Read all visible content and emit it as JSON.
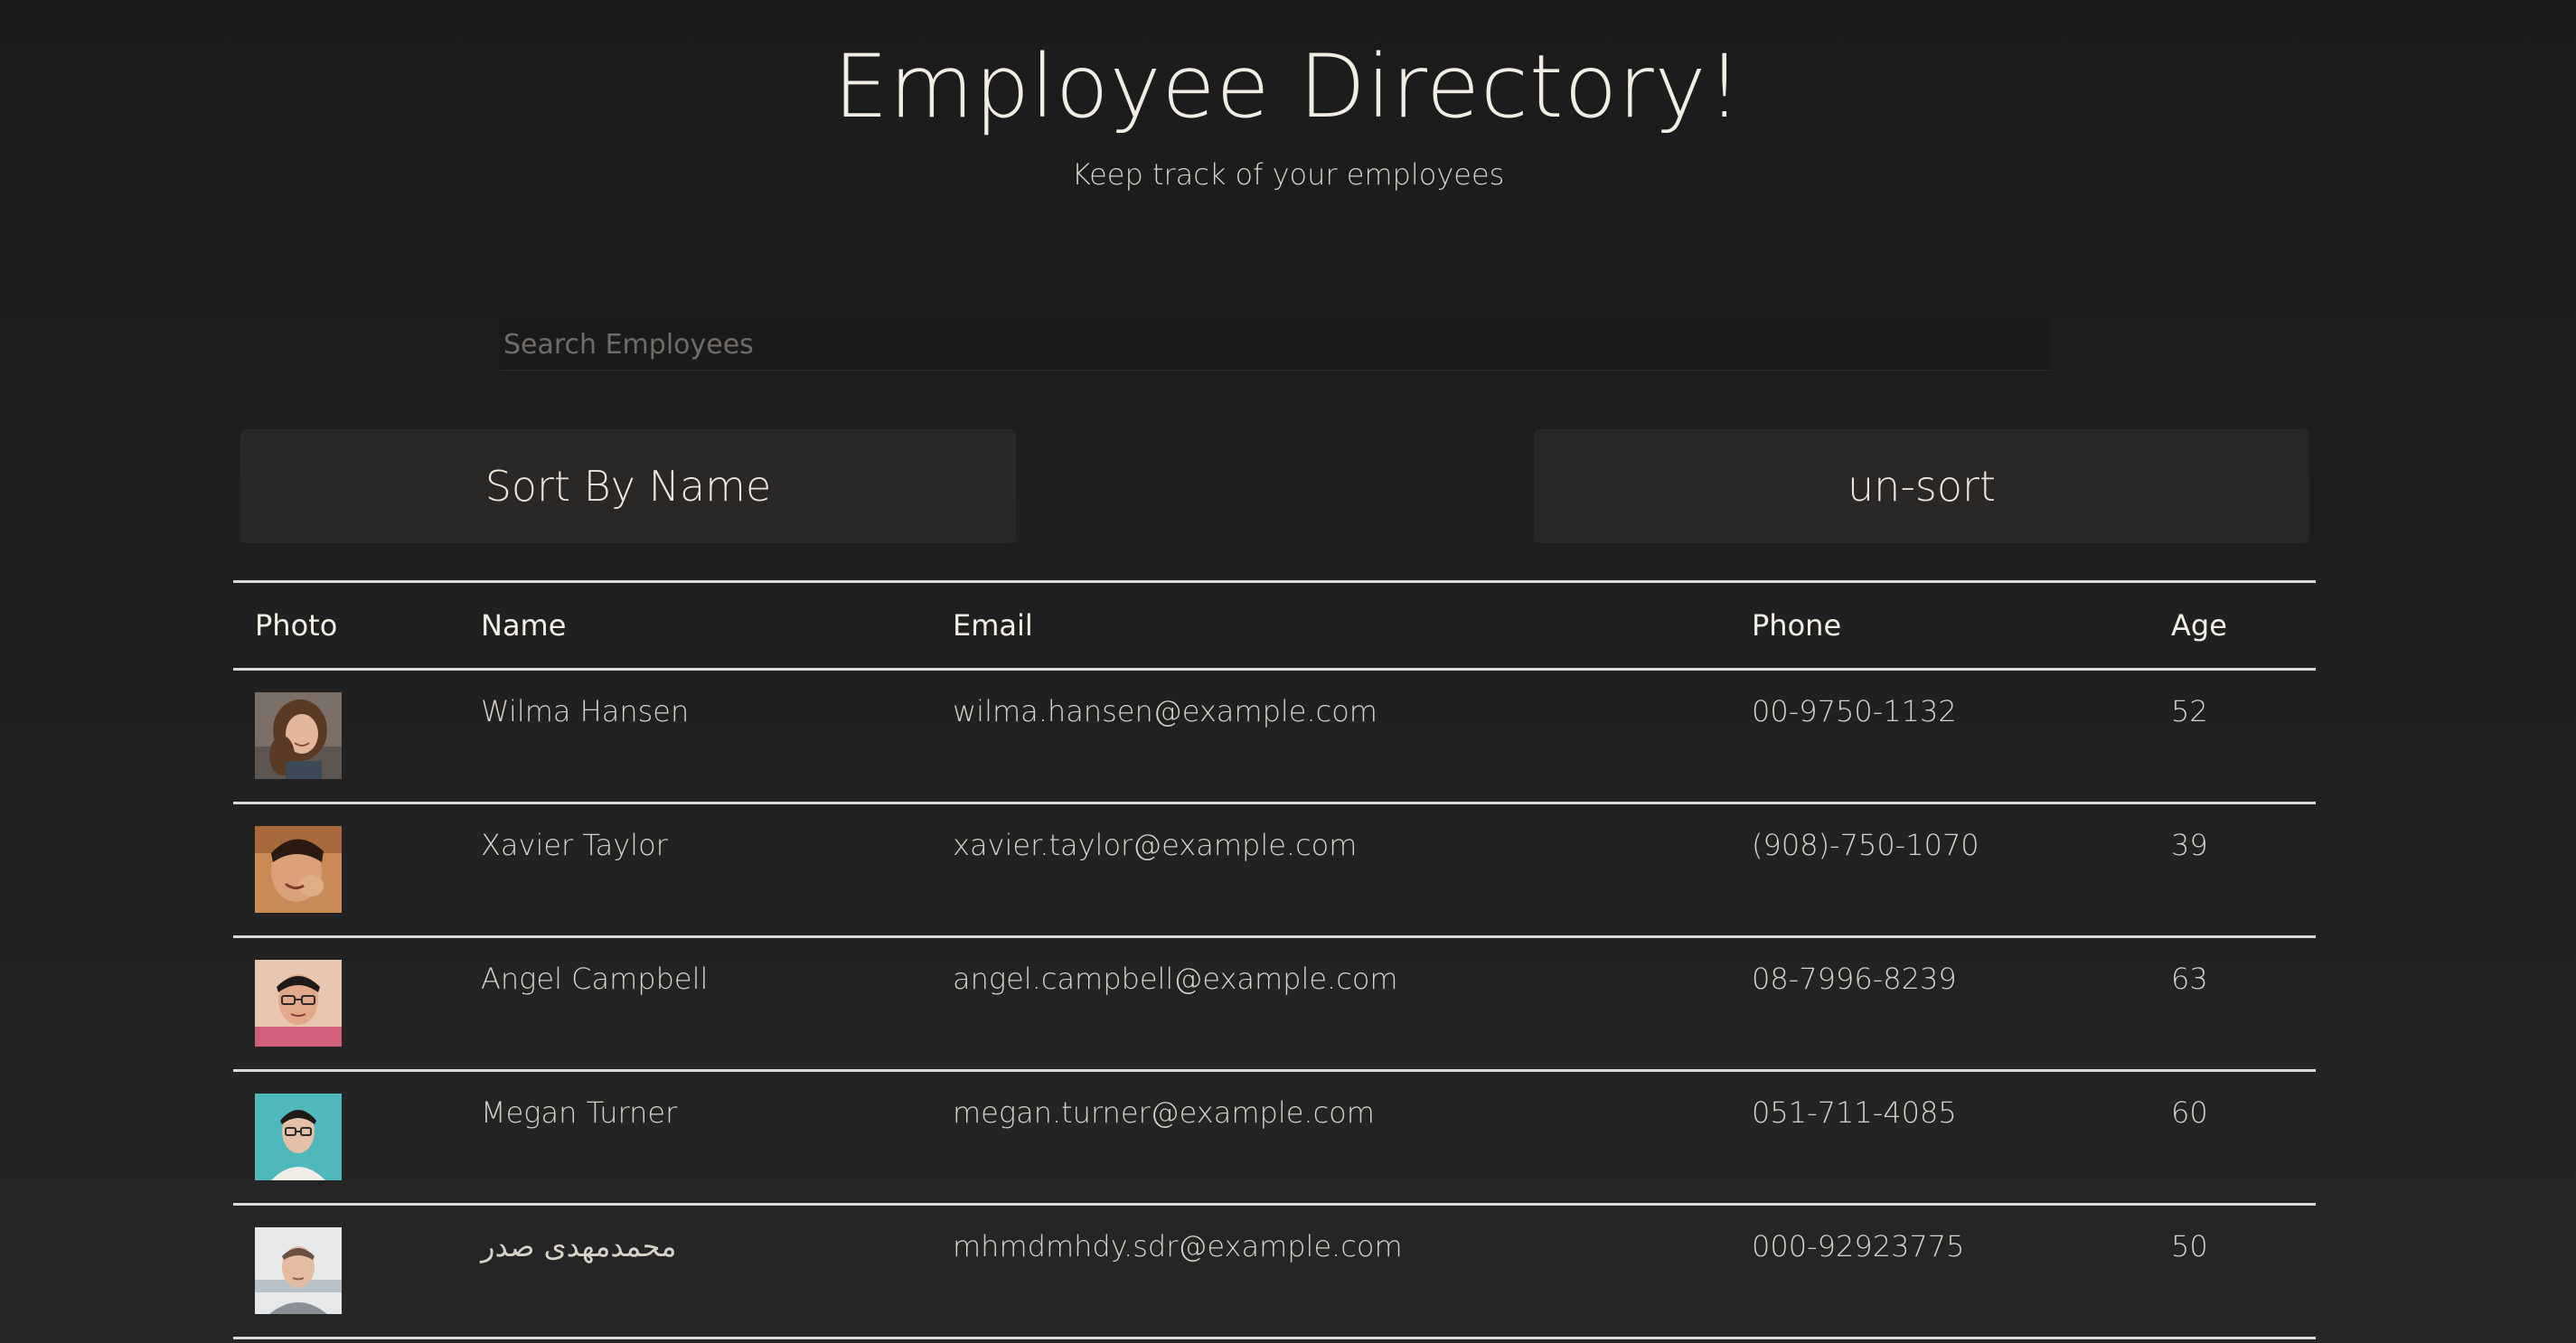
{
  "header": {
    "title": "Employee Directory!",
    "subtitle": "Keep track of your employees"
  },
  "search": {
    "placeholder": "Search Employees",
    "value": ""
  },
  "buttons": {
    "sort_label": "Sort By Name",
    "unsort_label": "un-sort"
  },
  "table": {
    "columns": [
      "Photo",
      "Name",
      "Email",
      "Phone",
      "Age"
    ],
    "rows": [
      {
        "photo": "avatar-woman-brown-hair",
        "name": "Wilma Hansen",
        "email": "wilma.hansen@example.com",
        "phone": "00-9750-1132",
        "age": "52"
      },
      {
        "photo": "avatar-man-dark-hair",
        "name": "Xavier Taylor",
        "email": "xavier.taylor@example.com",
        "phone": "(908)-750-1070",
        "age": "39"
      },
      {
        "photo": "avatar-man-glasses",
        "name": "Angel Campbell",
        "email": "angel.campbell@example.com",
        "phone": "08-7996-8239",
        "age": "63"
      },
      {
        "photo": "avatar-person-teal-background",
        "name": "Megan Turner",
        "email": "megan.turner@example.com",
        "phone": "051-711-4085",
        "age": "60"
      },
      {
        "photo": "avatar-man-light-background",
        "name": "محمدمهدی صدر",
        "email": "mhmdmhdy.sdr@example.com",
        "phone": "000-92923775",
        "age": "50"
      }
    ]
  }
}
